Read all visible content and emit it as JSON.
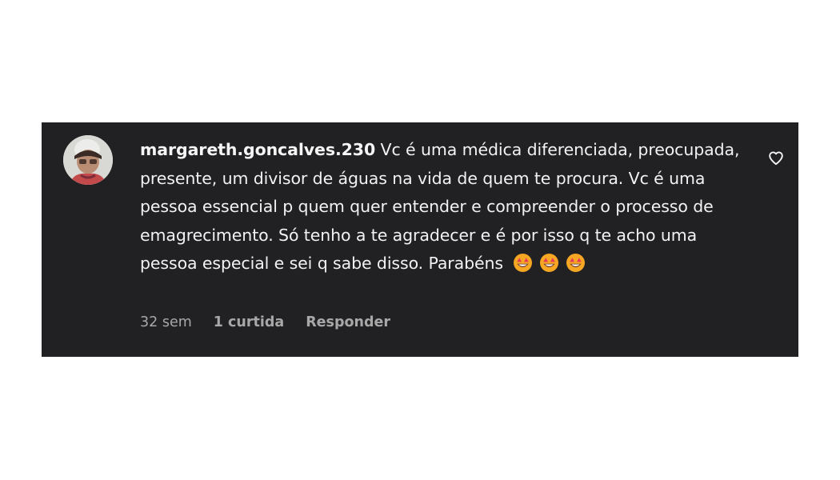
{
  "comment": {
    "username": "margareth.goncalves.230",
    "text": "Vc é uma médica diferenciada, preocupada, presente, um divisor de águas na vida de quem te procura. Vc é uma pessoa essencial p quem quer entender e compreender o processo de emagrecimento. Só tenho a te agradecer e é por isso q te acho uma pessoa especial e sei q sabe disso. Parabéns",
    "emojis": [
      "star-struck-emoji",
      "star-struck-emoji",
      "star-struck-emoji"
    ],
    "time": "32 sem",
    "likes": "1 curtida",
    "reply_label": "Responder"
  },
  "icons": {
    "like": "heart-outline-icon"
  },
  "colors": {
    "card_background": "#212124",
    "text": "#f2f2f2",
    "meta_text": "#a8a8a8",
    "emoji_face": "#f5a623",
    "emoji_eyes": "#e8395a"
  }
}
